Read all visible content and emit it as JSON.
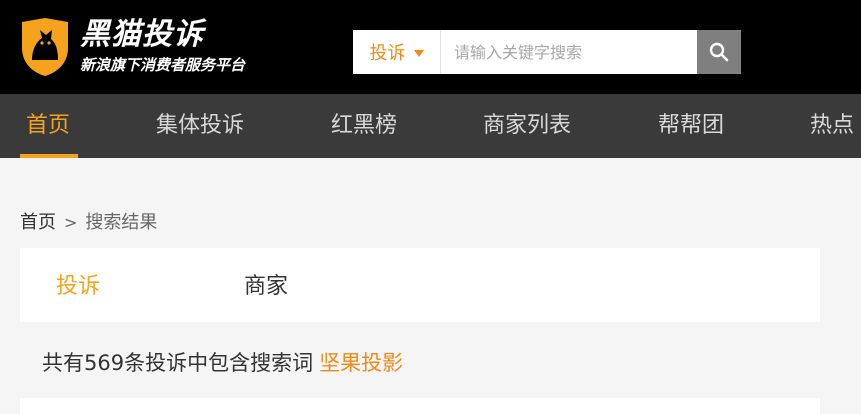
{
  "header": {
    "logo_title": "黑猫投诉",
    "logo_subtitle": "新浪旗下消费者服务平台",
    "logo_icon": "cat-shield-icon",
    "brand_color": "#f5a31c"
  },
  "search": {
    "selected_type": "投诉",
    "placeholder": "请输入关键字搜索",
    "value": "",
    "button_icon": "search-icon"
  },
  "nav": {
    "items": [
      {
        "label": "首页",
        "active": true
      },
      {
        "label": "集体投诉",
        "active": false
      },
      {
        "label": "红黑榜",
        "active": false
      },
      {
        "label": "商家列表",
        "active": false
      },
      {
        "label": "帮帮团",
        "active": false
      },
      {
        "label": "热点",
        "active": false
      }
    ]
  },
  "breadcrumb": {
    "home": "首页",
    "separator": ">",
    "current": "搜索结果"
  },
  "tabs": [
    {
      "label": "投诉",
      "active": true
    },
    {
      "label": "商家",
      "active": false
    }
  ],
  "results": {
    "summary_text": "共有569条投诉中包含搜索词",
    "keyword": "坚果投影"
  }
}
